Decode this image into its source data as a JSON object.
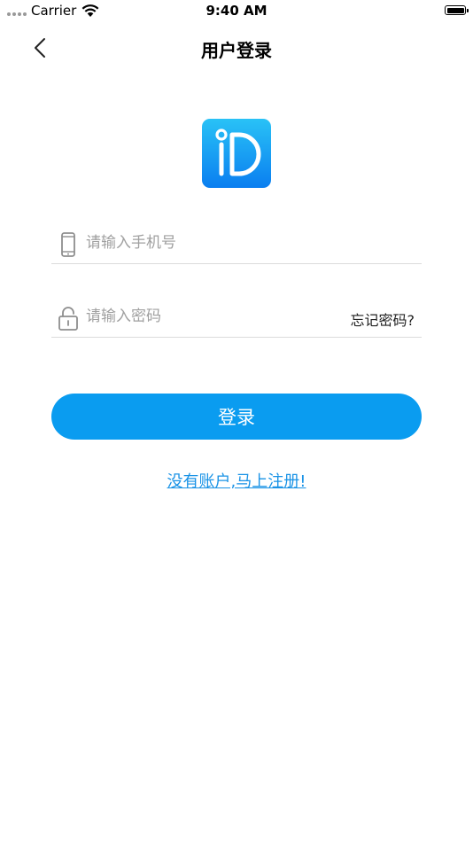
{
  "status_bar": {
    "carrier": "Carrier",
    "time": "9:40 AM"
  },
  "nav": {
    "title": "用户登录",
    "back_icon": "chevron-left-icon"
  },
  "logo": {
    "icon": "app-logo-icon",
    "gradient_top": "#29c2f6",
    "gradient_bottom": "#0a7ef0"
  },
  "form": {
    "phone": {
      "placeholder": "请输入手机号",
      "value": "",
      "icon": "phone-icon"
    },
    "password": {
      "placeholder": "请输入密码",
      "value": "",
      "icon": "unlock-icon",
      "forgot_label": "忘记密码?"
    },
    "login_label": "登录",
    "register_label": "没有账户,马上注册!"
  },
  "colors": {
    "accent": "#0a9cf0",
    "link": "#1a93e6",
    "placeholder": "#a0a0a0",
    "divider": "#dcdcdc"
  }
}
